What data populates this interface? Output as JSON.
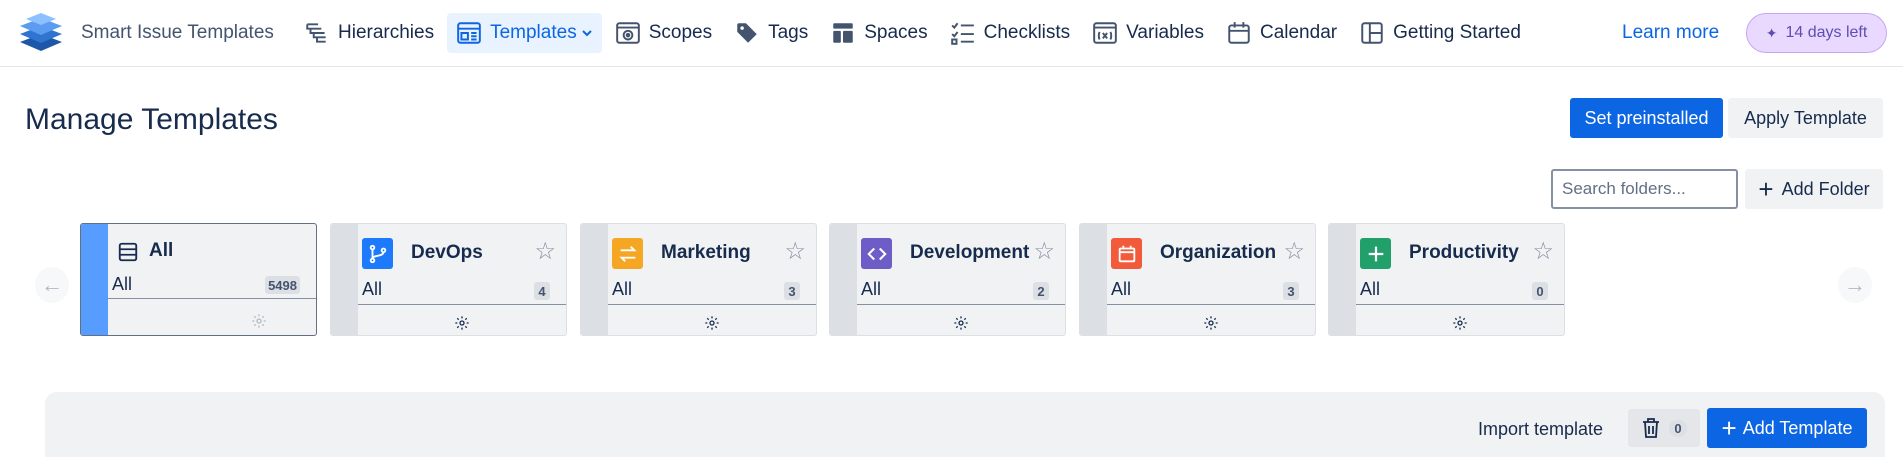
{
  "app": {
    "name": "Smart Issue Templates",
    "logo_icon": "layers-logo-icon"
  },
  "nav": {
    "items": [
      {
        "label": "Hierarchies",
        "icon": "hierarchy-icon"
      },
      {
        "label": "Templates",
        "icon": "template-icon",
        "active": true,
        "has_dropdown": true
      },
      {
        "label": "Scopes",
        "icon": "scope-icon"
      },
      {
        "label": "Tags",
        "icon": "tag-icon"
      },
      {
        "label": "Spaces",
        "icon": "spaces-icon"
      },
      {
        "label": "Checklists",
        "icon": "checklist-icon"
      },
      {
        "label": "Variables",
        "icon": "variable-icon"
      },
      {
        "label": "Calendar",
        "icon": "calendar-icon"
      },
      {
        "label": "Getting Started",
        "icon": "layout-icon"
      }
    ],
    "learn_more": "Learn more",
    "trial_badge": "14 days left"
  },
  "header": {
    "title": "Manage Templates",
    "set_preinstalled": "Set preinstalled",
    "apply_template": "Apply Template"
  },
  "folders_toolbar": {
    "search_placeholder": "Search folders...",
    "add_folder": "Add Folder"
  },
  "folders": [
    {
      "name": "All",
      "sub": "All",
      "count": "5498",
      "icon": "list-icon",
      "selected": true,
      "icon_color": "",
      "starrable": false
    },
    {
      "name": "DevOps",
      "sub": "All",
      "count": "4",
      "icon": "git-branch-icon",
      "icon_color": "#1d7afc"
    },
    {
      "name": "Marketing",
      "sub": "All",
      "count": "3",
      "icon": "swap-arrows-icon",
      "icon_color": "#f5a623"
    },
    {
      "name": "Development",
      "sub": "All",
      "count": "2",
      "icon": "code-icon",
      "icon_color": "#6e5dc6"
    },
    {
      "name": "Organization",
      "sub": "All",
      "count": "3",
      "icon": "calendar-icon",
      "icon_color": "#f15b3b"
    },
    {
      "name": "Productivity",
      "sub": "All",
      "count": "0",
      "icon": "plus-icon",
      "icon_color": "#22a06b"
    }
  ],
  "templates_panel": {
    "import": "Import template",
    "trash_count": "0",
    "add_template": "Add Template"
  },
  "colors": {
    "primary": "#0c66e4",
    "selected_stripe": "#579dff",
    "trial_bg": "#e9d9ff"
  }
}
